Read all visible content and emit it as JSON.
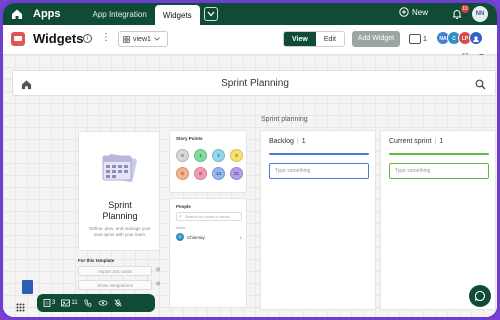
{
  "topbar": {
    "apps_label": "Apps",
    "tabs": [
      {
        "label": "App Integration",
        "active": false
      },
      {
        "label": "Widgets",
        "active": true
      }
    ],
    "new_label": "New",
    "notification_count": "10",
    "user_initials": "NN"
  },
  "header": {
    "title": "Widgets",
    "view_select": "view1",
    "view_label": "View",
    "edit_label": "Edit",
    "add_widget_label": "Add Widget",
    "counter": "1",
    "avatars": [
      {
        "initials": "NA",
        "color": "#3f7fd6"
      },
      {
        "initials": "C",
        "color": "#2f8ec4"
      },
      {
        "initials": "LP",
        "color": "#d94a4a"
      },
      {
        "initials": "",
        "color": "#3560c9"
      }
    ]
  },
  "sprint_bar": {
    "title": "Sprint Planning"
  },
  "intro_card": {
    "title_line1": "Sprint",
    "title_line2": "Planning",
    "description": "Define, plan, and manage your next sprint with your team.",
    "template_title": "For this template",
    "buttons": [
      "Import Jira cards",
      "Show integrations"
    ]
  },
  "story_points": {
    "title": "Story Points",
    "values": [
      {
        "label": "0",
        "color": "#d7d7d7"
      },
      {
        "label": "1",
        "color": "#7fdc9a"
      },
      {
        "label": "2",
        "color": "#8fd8ee"
      },
      {
        "label": "3",
        "color": "#f5e36b"
      },
      {
        "label": "5",
        "color": "#f5b38a"
      },
      {
        "label": "8",
        "color": "#f39ab6"
      },
      {
        "label": "13",
        "color": "#93b6f4"
      },
      {
        "label": "21",
        "color": "#b79af0"
      }
    ]
  },
  "people": {
    "title": "People",
    "search_placeholder": "Search by name or email",
    "section_label": "Notes",
    "person": {
      "initial": "C",
      "name": "Chinmay",
      "meta": "1"
    }
  },
  "kanban": {
    "title": "Sprint planning",
    "columns": [
      {
        "name": "Backlog",
        "count": "1",
        "placeholder": "Type something",
        "color": "#3f7fd6"
      },
      {
        "name": "Current sprint",
        "count": "1",
        "placeholder": "Type something",
        "color": "#5dbb46"
      }
    ]
  },
  "bottom_bar": {
    "notes_count": "3",
    "cards_count": "11"
  }
}
